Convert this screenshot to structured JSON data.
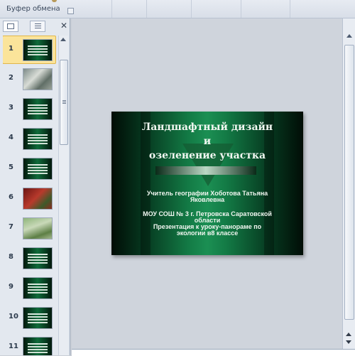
{
  "ribbon": {
    "group_label": "Буфер обмена"
  },
  "slides_panel": {
    "thumbnails": [
      {
        "number": "1",
        "style": "green",
        "active": true
      },
      {
        "number": "2",
        "style": "photo1"
      },
      {
        "number": "3",
        "style": "green"
      },
      {
        "number": "4",
        "style": "green"
      },
      {
        "number": "5",
        "style": "green"
      },
      {
        "number": "6",
        "style": "photo2"
      },
      {
        "number": "7",
        "style": "photo3"
      },
      {
        "number": "8",
        "style": "green"
      },
      {
        "number": "9",
        "style": "green"
      },
      {
        "number": "10",
        "style": "green"
      },
      {
        "number": "11",
        "style": "green"
      }
    ],
    "close_glyph": "✕"
  },
  "slide": {
    "title_line1": "Ландшафтный дизайн",
    "title_line2": "и",
    "title_line3": "озеленение участка",
    "author_line1": "Учитель географии Хоботова Татьяна",
    "author_line2": "Яковлевна",
    "school_line1": "МОУ СОШ № 3 г. Петровска Саратовской",
    "school_line2": "области",
    "topic_line1": "Презентация к  уроку-панораме по",
    "topic_line2": "экологии в8 классе"
  },
  "colors": {
    "slide_green": "#137a45",
    "active_thumb": "#fbe49a"
  }
}
